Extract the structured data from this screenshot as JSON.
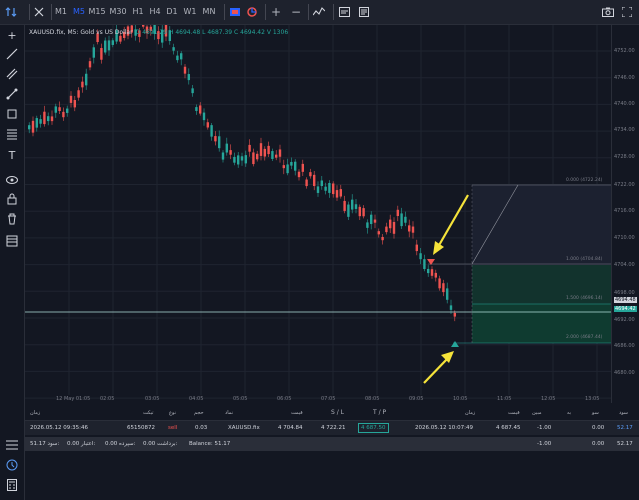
{
  "toolbar": {
    "timeframes": [
      "M1",
      "M5",
      "M15",
      "M30",
      "H1",
      "H4",
      "D1",
      "W1",
      "MN"
    ],
    "active_timeframe": "M5",
    "plus_label": "+",
    "minus_label": "−"
  },
  "legend": {
    "symbol": "XAUUSD.fix, M5: Gold vs US Dollar",
    "ohlc": "O 4691.29 H 4694.48 L 4687.39 C 4694.42 V 1306"
  },
  "price_axis": {
    "ticks": [
      "4752.00",
      "4746.00",
      "4740.00",
      "4734.00",
      "4728.00",
      "4722.00",
      "4716.00",
      "4710.00",
      "4704.00",
      "4698.00",
      "4692.00",
      "4686.00",
      "4680.00"
    ],
    "label_ask": "4694.48",
    "label_bid": "4694.42"
  },
  "time_axis": {
    "labels": [
      "12 May 01:05",
      "02:05",
      "03:05",
      "04:05",
      "05:05",
      "06:05",
      "07:05",
      "08:05",
      "09:05",
      "10:05",
      "11:05",
      "12:05",
      "13:05"
    ]
  },
  "fib_levels": [
    "0.000 (4722.24)",
    "1.000 (4704.84)",
    "1.500 (4696.14)",
    "2.000 (4687.44)"
  ],
  "table": {
    "headers": [
      "زمان",
      "تیکت",
      "نوع",
      "حجم",
      "نماد",
      "قیمت",
      "S / L",
      "T / P",
      "زمان",
      "قیمت",
      "مبین",
      "به",
      "سو",
      "سود"
    ],
    "row": {
      "time_open": "2026.05.12 09:35:46",
      "ticket": "65150872",
      "type": "sell",
      "volume": "0.03",
      "symbol": "XAUUSD.fix",
      "price": "4 704.84",
      "sl": "4 722.21",
      "tp": "4 687.50",
      "time_now": "2026.05.12 10:07:49",
      "price_now": "4 687.45",
      "col_a": "-1.00",
      "col_b": "0.00",
      "profit": "52.17"
    },
    "totals": {
      "profit_lbl": "سود:",
      "profit_val": "51.17",
      "credit_lbl": "اعتبار:",
      "credit_val": "0.00",
      "deposit_lbl": "سپرده:",
      "deposit_val": "0.00",
      "withdraw_lbl": "برداشت:",
      "withdraw_val": "0.00",
      "balance_lbl": "Balance:",
      "balance_val": "51.17",
      "col_a": "-1.00",
      "col_b": "0.00",
      "total": "52.17"
    }
  },
  "colors": {
    "bull": "#26a69a",
    "bear": "#ef5350",
    "accent": "#2962ff",
    "arrow": "#f5e33a"
  }
}
